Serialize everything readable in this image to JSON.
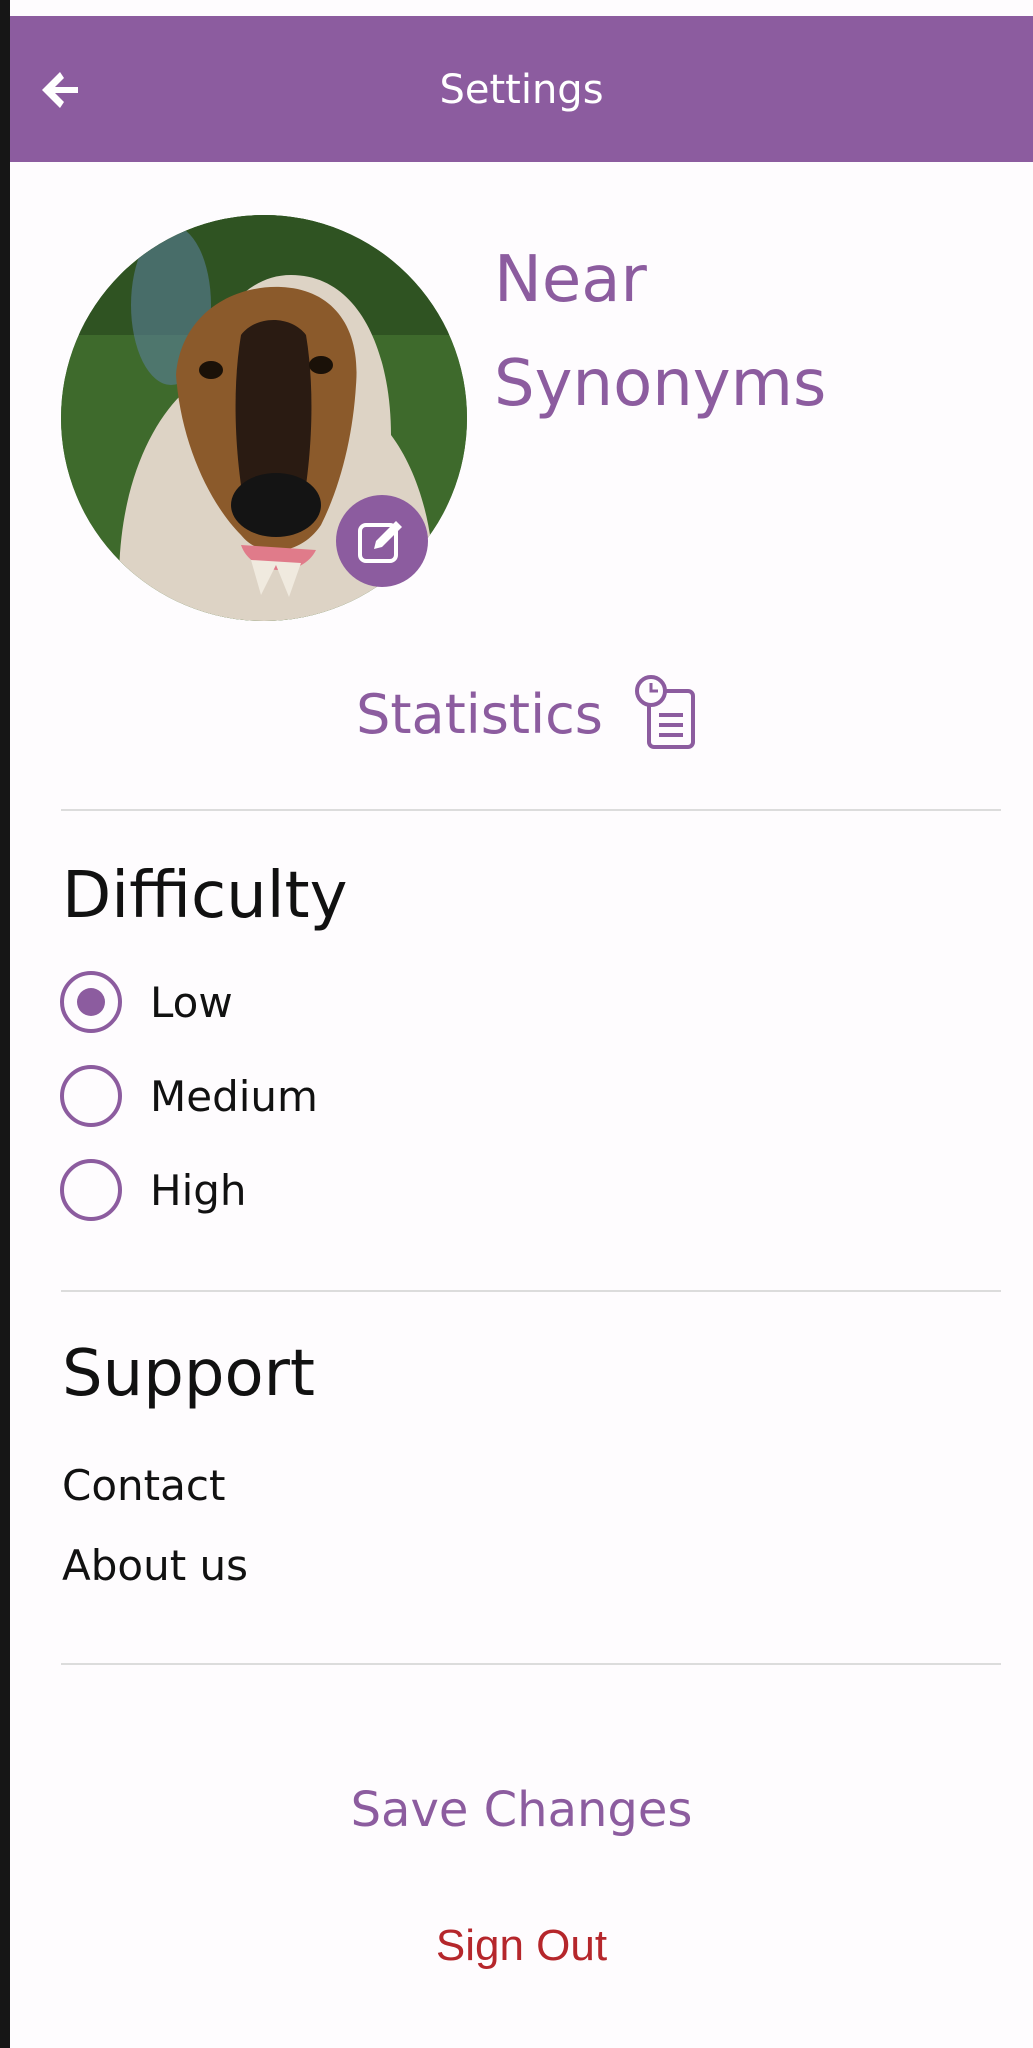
{
  "header": {
    "title": "Settings",
    "back_icon": "arrow-left-icon",
    "background": "#8c5c9f"
  },
  "profile": {
    "name_line1": "Near",
    "name_line2": "Synonyms",
    "avatar_description": "profile-photo",
    "edit_icon": "edit-pencil-icon"
  },
  "statistics": {
    "label": "Statistics",
    "icon": "report-clock-icon"
  },
  "difficulty": {
    "title": "Difficulty",
    "options": [
      {
        "label": "Low",
        "selected": true
      },
      {
        "label": "Medium",
        "selected": false
      },
      {
        "label": "High",
        "selected": false
      }
    ]
  },
  "support": {
    "title": "Support",
    "links": [
      "Contact",
      "About us"
    ]
  },
  "actions": {
    "save_label": "Save Changes",
    "signout_label": "Sign Out"
  },
  "colors": {
    "accent": "#8c5c9f",
    "danger": "#b5262b",
    "text": "#111111"
  }
}
